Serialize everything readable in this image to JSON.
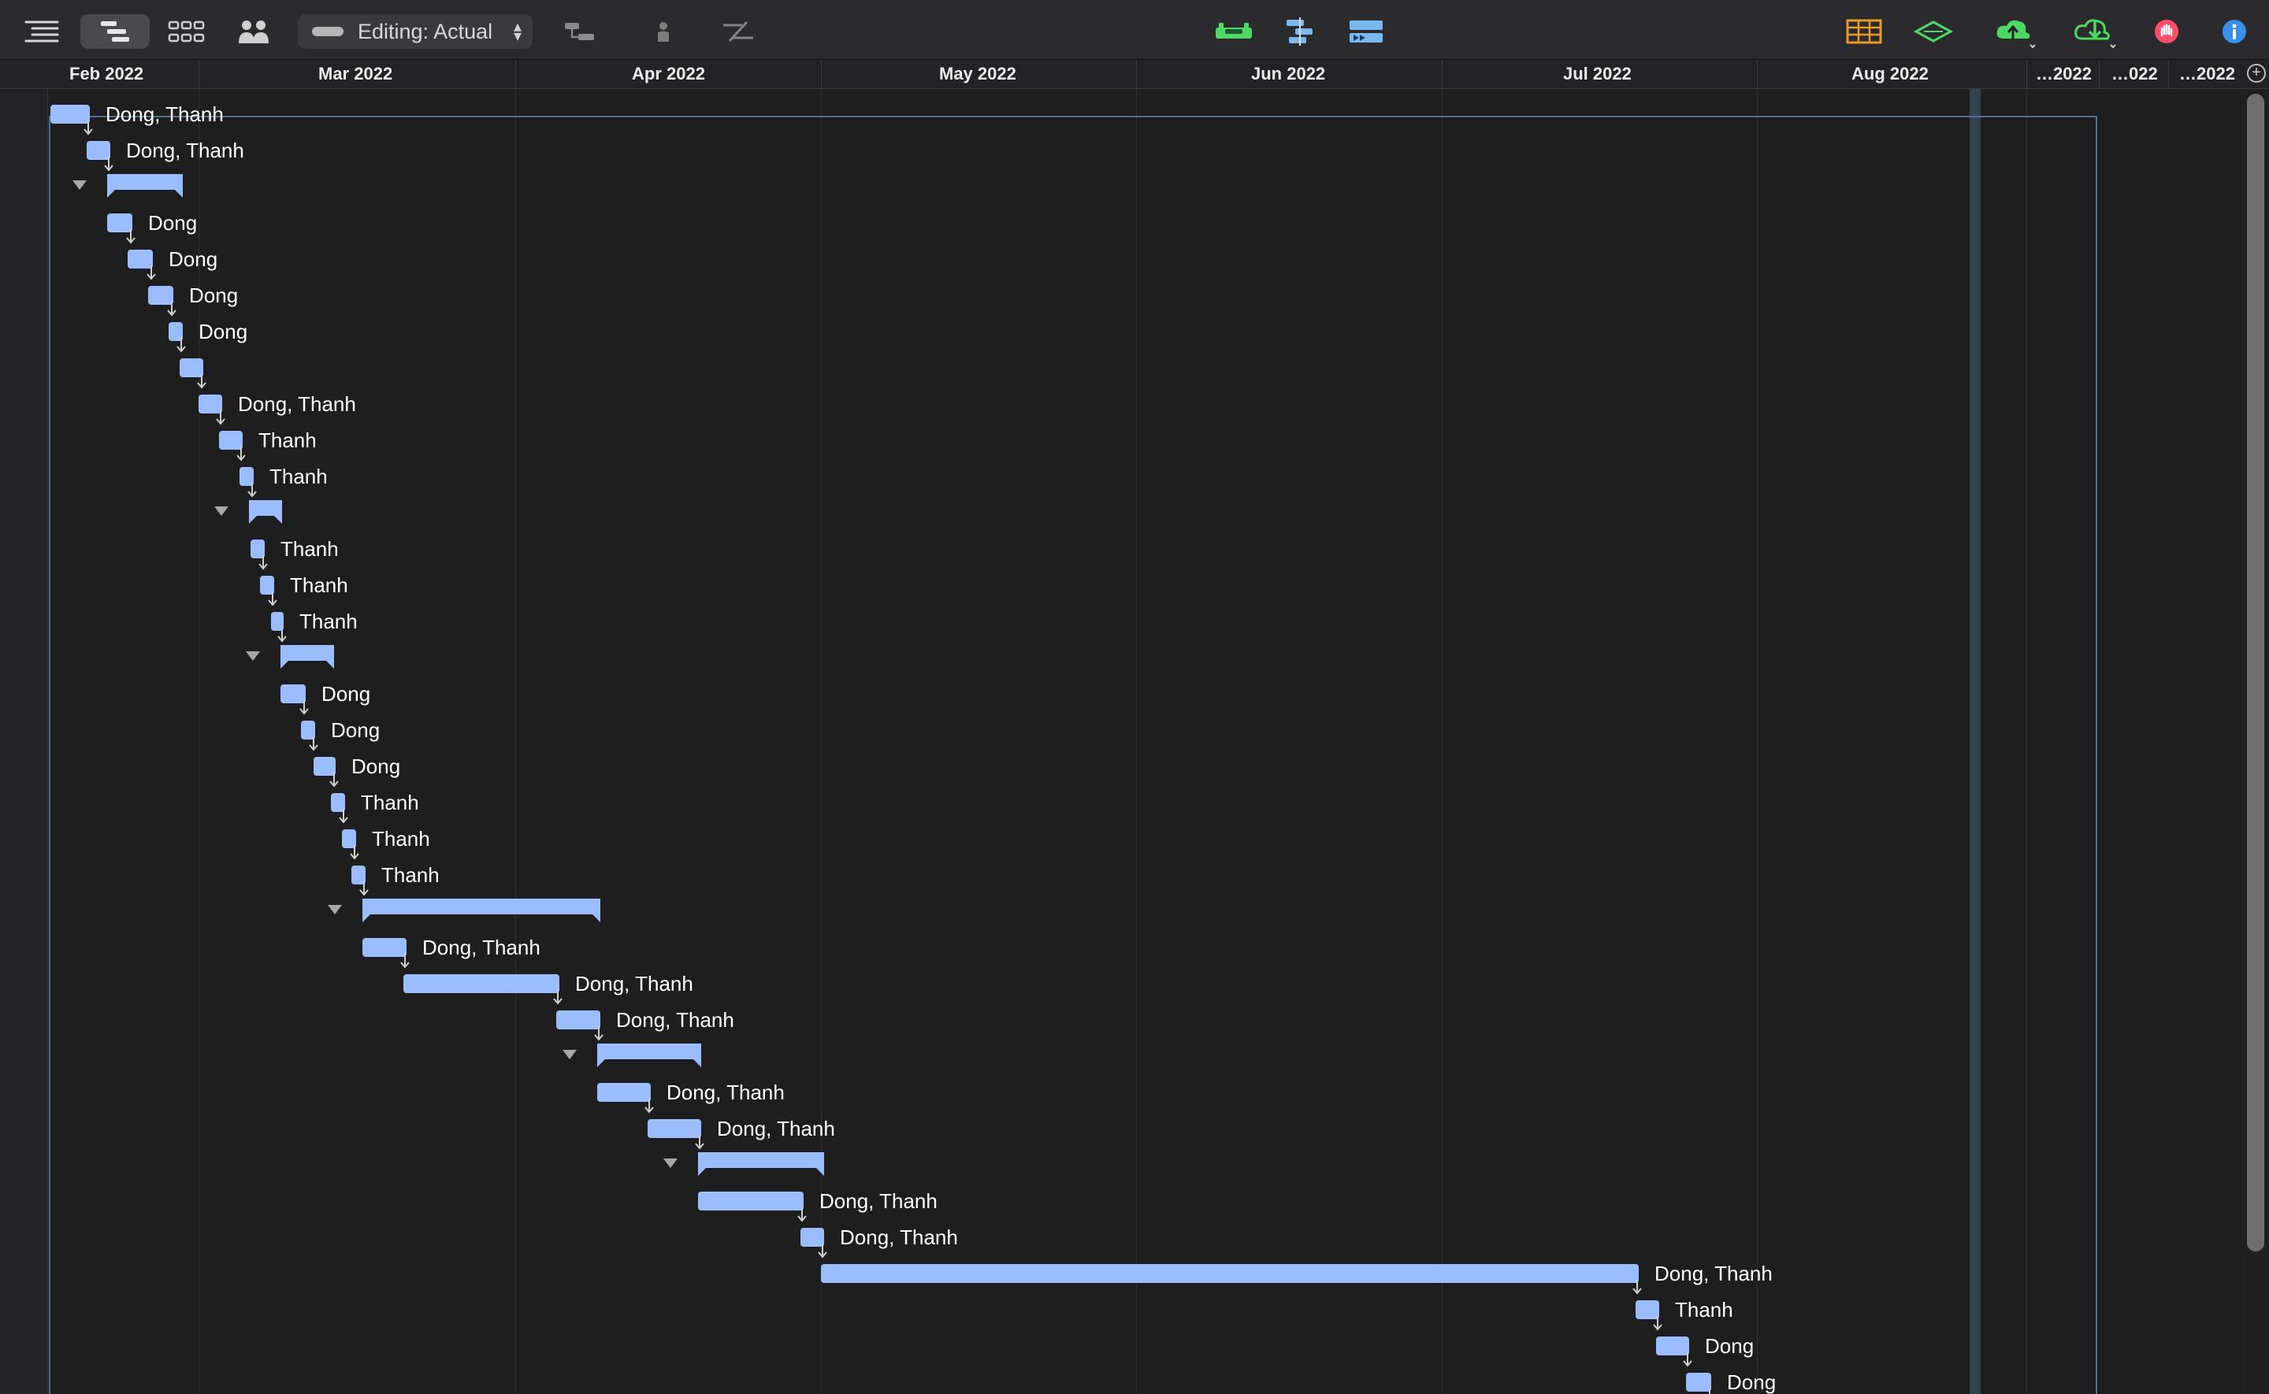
{
  "toolbar": {
    "editing_label": "Editing: Actual"
  },
  "timeline": {
    "months": [
      "Feb 2022",
      "Mar 2022",
      "Apr 2022",
      "May 2022",
      "Jun 2022",
      "Jul 2022",
      "Aug 2022",
      "…2022",
      "…022",
      "…2022"
    ]
  },
  "tasks": [
    {
      "label": "Dong, Thanh"
    },
    {
      "label": "Dong, Thanh"
    },
    {
      "label": ""
    },
    {
      "label": "Dong"
    },
    {
      "label": "Dong"
    },
    {
      "label": "Dong"
    },
    {
      "label": "Dong"
    },
    {
      "label": ""
    },
    {
      "label": "Dong, Thanh"
    },
    {
      "label": "Thanh"
    },
    {
      "label": "Thanh"
    },
    {
      "label": ""
    },
    {
      "label": "Thanh"
    },
    {
      "label": "Thanh"
    },
    {
      "label": "Thanh"
    },
    {
      "label": ""
    },
    {
      "label": "Dong"
    },
    {
      "label": "Dong"
    },
    {
      "label": "Dong"
    },
    {
      "label": "Thanh"
    },
    {
      "label": "Thanh"
    },
    {
      "label": "Thanh"
    },
    {
      "label": ""
    },
    {
      "label": "Dong, Thanh"
    },
    {
      "label": "Dong, Thanh"
    },
    {
      "label": "Dong, Thanh"
    },
    {
      "label": ""
    },
    {
      "label": "Dong, Thanh"
    },
    {
      "label": "Dong, Thanh"
    },
    {
      "label": ""
    },
    {
      "label": "Dong, Thanh"
    },
    {
      "label": "Dong, Thanh"
    },
    {
      "label": "Dong, Thanh"
    },
    {
      "label": "Thanh"
    },
    {
      "label": "Dong"
    },
    {
      "label": "Dong"
    }
  ],
  "icons": {
    "toolbar_left": [
      "sidebar-toggle-icon",
      "gantt-view-icon",
      "network-view-icon",
      "resources-view-icon"
    ],
    "toolbar_mid": [
      "connect-tasks-icon",
      "resource-person-icon",
      "split-task-icon"
    ],
    "toolbar_center": [
      "baseline-icon",
      "level-resources-icon",
      "critical-path-icon"
    ],
    "toolbar_right": [
      "table-icon",
      "milestone-icon",
      "publish-icon",
      "sync-icon",
      "stop-icon",
      "info-icon"
    ]
  },
  "colors": {
    "task_bar": "#9cbdfd",
    "baseline_frame": "#4f6f8f",
    "today_band": "#34444e",
    "green_tool": "#4cd964",
    "blue_tool": "#7ab8f0"
  }
}
